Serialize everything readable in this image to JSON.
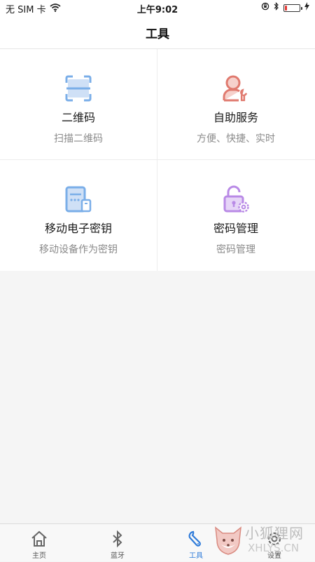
{
  "status_bar": {
    "carrier": "无 SIM 卡",
    "time": "上午9:02",
    "battery_level": 0.15
  },
  "nav": {
    "title": "工具"
  },
  "tools": [
    {
      "title": "二维码",
      "subtitle": "扫描二维码",
      "icon": "qr-scan-icon",
      "color": "#7aaee8"
    },
    {
      "title": "自助服务",
      "subtitle": "方便、快捷、实时",
      "icon": "user-service-icon",
      "color": "#e07a6f"
    },
    {
      "title": "移动电子密钥",
      "subtitle": "移动设备作为密钥",
      "icon": "mobile-key-icon",
      "color": "#7aaee8"
    },
    {
      "title": "密码管理",
      "subtitle": "密码管理",
      "icon": "lock-gear-icon",
      "color": "#b98ae6"
    }
  ],
  "tab_bar": {
    "tabs": [
      {
        "label": "主页",
        "icon": "home-icon"
      },
      {
        "label": "蓝牙",
        "icon": "bluetooth-icon"
      },
      {
        "label": "工具",
        "icon": "wrench-icon",
        "active": true
      },
      {
        "label": "设置",
        "icon": "settings-icon"
      }
    ]
  },
  "watermark": {
    "text": "小狐狸网",
    "sub": "XHLYS.CN"
  },
  "colors": {
    "accent": "#2f7bd9",
    "divider": "#ececec",
    "background": "#f5f5f5"
  }
}
